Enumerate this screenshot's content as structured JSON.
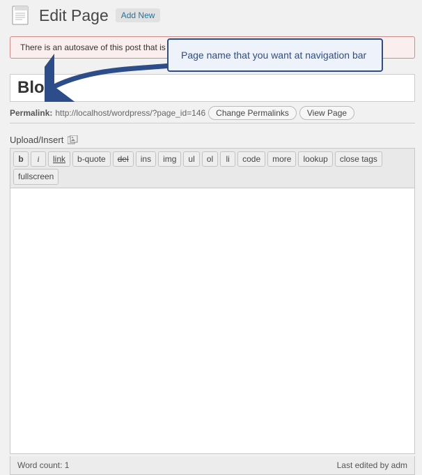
{
  "header": {
    "title": "Edit Page",
    "add_new_label": "Add New"
  },
  "notice": {
    "text": "There is an autosave of this post that is more recent than the version below."
  },
  "title_field": {
    "value": "Blog"
  },
  "permalink": {
    "label": "Permalink:",
    "url": "http://localhost/wordpress/?page_id=146",
    "change_label": "Change Permalinks",
    "view_label": "View Page"
  },
  "upload": {
    "label": "Upload/Insert"
  },
  "quicktags": [
    {
      "id": "b",
      "label": "b"
    },
    {
      "id": "i",
      "label": "i"
    },
    {
      "id": "link",
      "label": "link"
    },
    {
      "id": "bquote",
      "label": "b-quote"
    },
    {
      "id": "del",
      "label": "del"
    },
    {
      "id": "ins",
      "label": "ins"
    },
    {
      "id": "img",
      "label": "img"
    },
    {
      "id": "ul",
      "label": "ul"
    },
    {
      "id": "ol",
      "label": "ol"
    },
    {
      "id": "li",
      "label": "li"
    },
    {
      "id": "code",
      "label": "code"
    },
    {
      "id": "more",
      "label": "more"
    },
    {
      "id": "lookup",
      "label": "lookup"
    },
    {
      "id": "closetags",
      "label": "close tags"
    },
    {
      "id": "fullscreen",
      "label": "fullscreen"
    }
  ],
  "editor": {
    "content": ""
  },
  "status": {
    "word_count_label": "Word count: 1",
    "last_edited_label": "Last edited by adm"
  },
  "annotation": {
    "callout_text": "Page name that you want at navigation bar"
  }
}
